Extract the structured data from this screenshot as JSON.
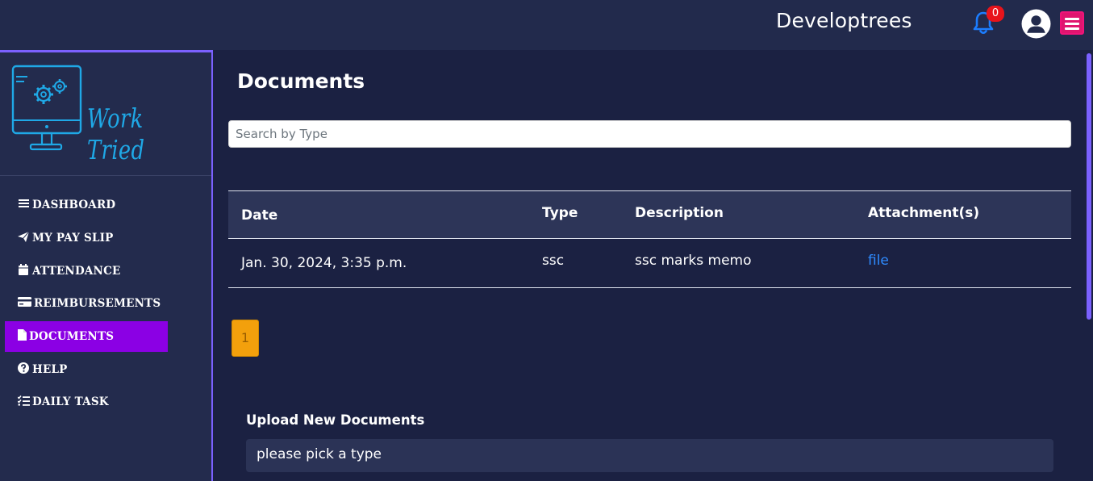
{
  "header": {
    "brand": "Developtrees",
    "notification_count": "0"
  },
  "logo": {
    "text": "Work Tried"
  },
  "sidebar": {
    "items": [
      {
        "label": "DASHBOARD",
        "icon": "bars-icon"
      },
      {
        "label": "MY PAY SLIP",
        "icon": "paper-plane-icon"
      },
      {
        "label": "ATTENDANCE",
        "icon": "calendar-icon"
      },
      {
        "label": "REIMBURSEMENTS",
        "icon": "credit-card-icon"
      },
      {
        "label": "DOCUMENTS",
        "icon": "file-icon",
        "active": true
      },
      {
        "label": "HELP",
        "icon": "question-circle-icon"
      },
      {
        "label": "DAILY TASK",
        "icon": "tasks-icon"
      }
    ]
  },
  "main": {
    "title": "Documents",
    "search": {
      "placeholder": "Search by Type",
      "value": ""
    },
    "table": {
      "headers": [
        "Date",
        "Type",
        "Description",
        "Attachment(s)"
      ],
      "rows": [
        {
          "date": "Jan. 30, 2024, 3:35 p.m.",
          "type": "ssc",
          "description": "ssc marks memo",
          "attachment": "file"
        }
      ]
    },
    "pagination": {
      "current": "1"
    },
    "upload": {
      "title": "Upload New Documents",
      "type_select": "please pick a type"
    }
  },
  "colors": {
    "background": "#1b2142",
    "sidebar": "#232b4d",
    "accent_border": "#7b61ff",
    "active_nav": "#8b00e4",
    "pagination": "#f3a00c",
    "link": "#2f8bff",
    "badge": "#e8141b",
    "menu_button": "#e0156f"
  }
}
